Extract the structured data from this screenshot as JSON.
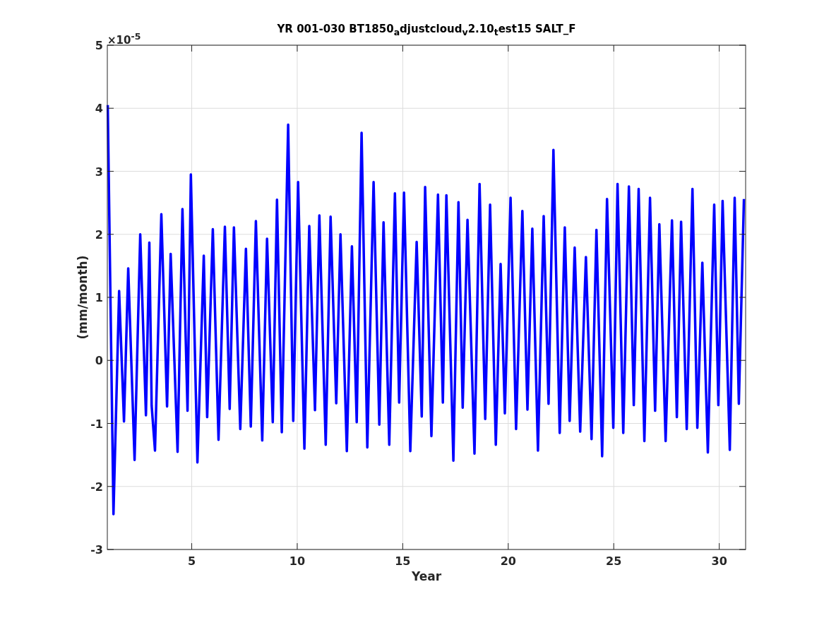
{
  "figure": {
    "title": "YR 001-030 BT1850$_{a}$djustcloud$_{v}$2.10$_{t}$est15 SALT_F",
    "y_multiplier": "×10$^{-5}$",
    "chart_data": {
      "type": "line",
      "grid": true,
      "xlabel": "Year",
      "ylabel": "(mm/month)",
      "xlim": [
        1,
        31.25
      ],
      "ylim": [
        -3,
        5
      ],
      "xticks": [
        5,
        10,
        15,
        20,
        25,
        30
      ],
      "yticks": [
        -3,
        -2,
        -1,
        0,
        1,
        2,
        3,
        4,
        5
      ],
      "x": [
        1.02,
        1.29,
        1.56,
        1.79,
        1.99,
        2.29,
        2.56,
        2.83,
        2.99,
        3.1,
        3.26,
        3.56,
        3.83,
        4.0,
        4.33,
        4.56,
        4.8,
        4.96,
        5.27,
        5.57,
        5.73,
        6.0,
        6.27,
        6.57,
        6.8,
        7.0,
        7.3,
        7.57,
        7.8,
        8.04,
        8.34,
        8.57,
        8.84,
        9.04,
        9.27,
        9.57,
        9.81,
        10.04,
        10.34,
        10.57,
        10.84,
        11.05,
        11.35,
        11.58,
        11.85,
        12.05,
        12.35,
        12.59,
        12.82,
        13.05,
        13.32,
        13.62,
        13.89,
        14.09,
        14.36,
        14.63,
        14.83,
        15.06,
        15.36,
        15.66,
        15.9,
        16.06,
        16.36,
        16.67,
        16.9,
        17.07,
        17.4,
        17.64,
        17.84,
        18.07,
        18.4,
        18.64,
        18.91,
        19.14,
        19.41,
        19.64,
        19.84,
        20.11,
        20.37,
        20.67,
        20.91,
        21.14,
        21.41,
        21.68,
        21.91,
        22.14,
        22.44,
        22.68,
        22.91,
        23.15,
        23.41,
        23.68,
        23.95,
        24.18,
        24.45,
        24.68,
        24.98,
        25.18,
        25.45,
        25.72,
        25.95,
        26.18,
        26.45,
        26.72,
        26.96,
        27.16,
        27.46,
        27.76,
        27.99,
        28.19,
        28.46,
        28.73,
        28.96,
        29.2,
        29.46,
        29.76,
        29.96,
        30.16,
        30.5,
        30.73,
        30.93,
        31.17
      ],
      "series": [
        {
          "color": "#0000ff",
          "values": [
            4.05,
            -2.44,
            1.1,
            -0.97,
            1.46,
            -1.58,
            2.0,
            -0.87,
            1.87,
            -0.72,
            -1.43,
            2.32,
            -0.73,
            1.69,
            -1.45,
            2.4,
            -0.8,
            2.95,
            -1.62,
            1.66,
            -0.9,
            2.08,
            -1.26,
            2.12,
            -0.77,
            2.11,
            -1.09,
            1.77,
            -1.05,
            2.21,
            -1.27,
            1.93,
            -0.98,
            2.55,
            -1.14,
            3.74,
            -0.96,
            2.83,
            -1.4,
            2.13,
            -0.79,
            2.3,
            -1.34,
            2.28,
            -0.68,
            2.0,
            -1.44,
            1.81,
            -0.98,
            3.61,
            -1.38,
            2.83,
            -1.02,
            2.19,
            -1.34,
            2.65,
            -0.67,
            2.66,
            -1.44,
            1.88,
            -0.89,
            2.75,
            -1.2,
            2.63,
            -0.67,
            2.62,
            -1.59,
            2.51,
            -0.75,
            2.23,
            -1.48,
            2.8,
            -0.93,
            2.47,
            -1.34,
            1.53,
            -0.84,
            2.58,
            -1.09,
            2.37,
            -0.78,
            2.09,
            -1.43,
            2.29,
            -0.69,
            3.34,
            -1.15,
            2.11,
            -0.96,
            1.79,
            -1.13,
            1.64,
            -1.25,
            2.07,
            -1.52,
            2.56,
            -1.07,
            2.8,
            -1.15,
            2.76,
            -0.71,
            2.72,
            -1.28,
            2.58,
            -0.8,
            2.16,
            -1.28,
            2.22,
            -0.9,
            2.2,
            -1.09,
            2.72,
            -1.07,
            1.55,
            -1.46,
            2.47,
            -0.71,
            2.53,
            -1.42,
            2.58,
            -0.69,
            2.56
          ]
        }
      ]
    }
  }
}
